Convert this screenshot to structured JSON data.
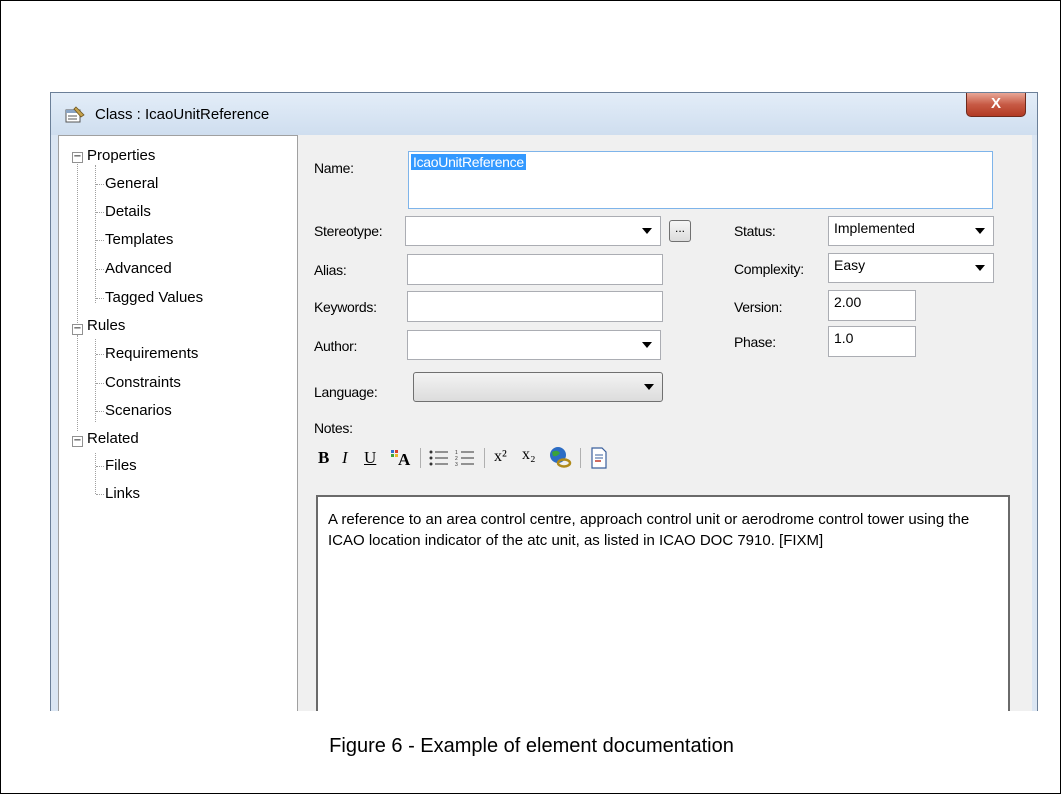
{
  "window": {
    "title": "Class : IcaoUnitReference",
    "close_label": "X"
  },
  "tree": {
    "groups": [
      {
        "label": "Properties",
        "children": [
          "General",
          "Details",
          "Templates",
          "Advanced",
          "Tagged Values"
        ]
      },
      {
        "label": "Rules",
        "children": [
          "Requirements",
          "Constraints",
          "Scenarios"
        ]
      },
      {
        "label": "Related",
        "children": [
          "Files",
          "Links"
        ]
      }
    ],
    "expander_symbol": "−"
  },
  "form": {
    "name_label": "Name:",
    "name_value": "IcaoUnitReference",
    "stereotype_label": "Stereotype:",
    "stereotype_value": "",
    "ellipsis_label": "...",
    "alias_label": "Alias:",
    "alias_value": "",
    "keywords_label": "Keywords:",
    "keywords_value": "",
    "author_label": "Author:",
    "author_value": "",
    "language_label": "Language:",
    "language_value": "",
    "status_label": "Status:",
    "status_value": "Implemented",
    "complexity_label": "Complexity:",
    "complexity_value": "Easy",
    "version_label": "Version:",
    "version_value": "2.00",
    "phase_label": "Phase:",
    "phase_value": "1.0",
    "notes_label": "Notes:"
  },
  "toolbar": {
    "bold": "B",
    "italic": "I",
    "underline": "U",
    "superscript": "x²",
    "subscript": "x₂"
  },
  "notes": {
    "text": "A reference to an area control centre, approach control unit or aerodrome control tower using the ICAO location indicator of the atc unit, as listed in ICAO DOC 7910. [FIXM]"
  },
  "caption": "Figure 6 - Example of element documentation",
  "colors": {
    "selection": "#3399ff",
    "close_button": "#c75a45",
    "dialog_frame": "#dbe6f3"
  }
}
